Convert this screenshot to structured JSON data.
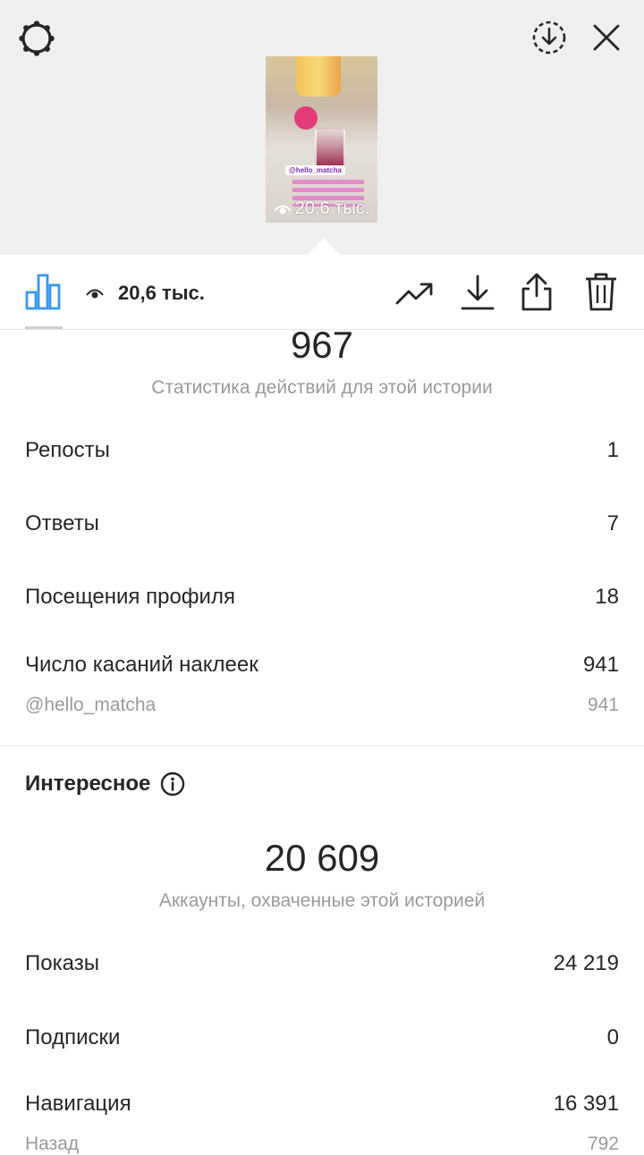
{
  "header": {
    "story_views_overlay": "20,6 тыс.",
    "sticker_tag": "@hello_matcha"
  },
  "toolbar": {
    "views": "20,6 тыс."
  },
  "interactions": {
    "total": "967",
    "caption": "Статистика действий для этой истории",
    "rows": [
      {
        "label": "Репосты",
        "value": "1"
      },
      {
        "label": "Ответы",
        "value": "7"
      },
      {
        "label": "Посещения профиля",
        "value": "18"
      },
      {
        "label": "Число касаний наклеек",
        "value": "941"
      }
    ],
    "sticker_row": {
      "label": "@hello_matcha",
      "value": "941"
    }
  },
  "discovery": {
    "title": "Интересное",
    "total": "20 609",
    "caption": "Аккаунты, охваченные этой историей",
    "rows": [
      {
        "label": "Показы",
        "value": "24 219"
      },
      {
        "label": "Подписки",
        "value": "0"
      },
      {
        "label": "Навигация",
        "value": "16 391"
      }
    ],
    "partial_row": {
      "label": "Назад",
      "value": "792"
    }
  },
  "colors": {
    "accent": "#3897f0",
    "text": "#262626",
    "muted": "#9a9a9a",
    "header_bg": "#efefef"
  },
  "icons": [
    "settings-gear-icon",
    "download-circle-icon",
    "close-icon",
    "bar-chart-icon",
    "eye-icon",
    "trending-icon",
    "download-icon",
    "share-icon",
    "trash-icon",
    "info-icon"
  ]
}
